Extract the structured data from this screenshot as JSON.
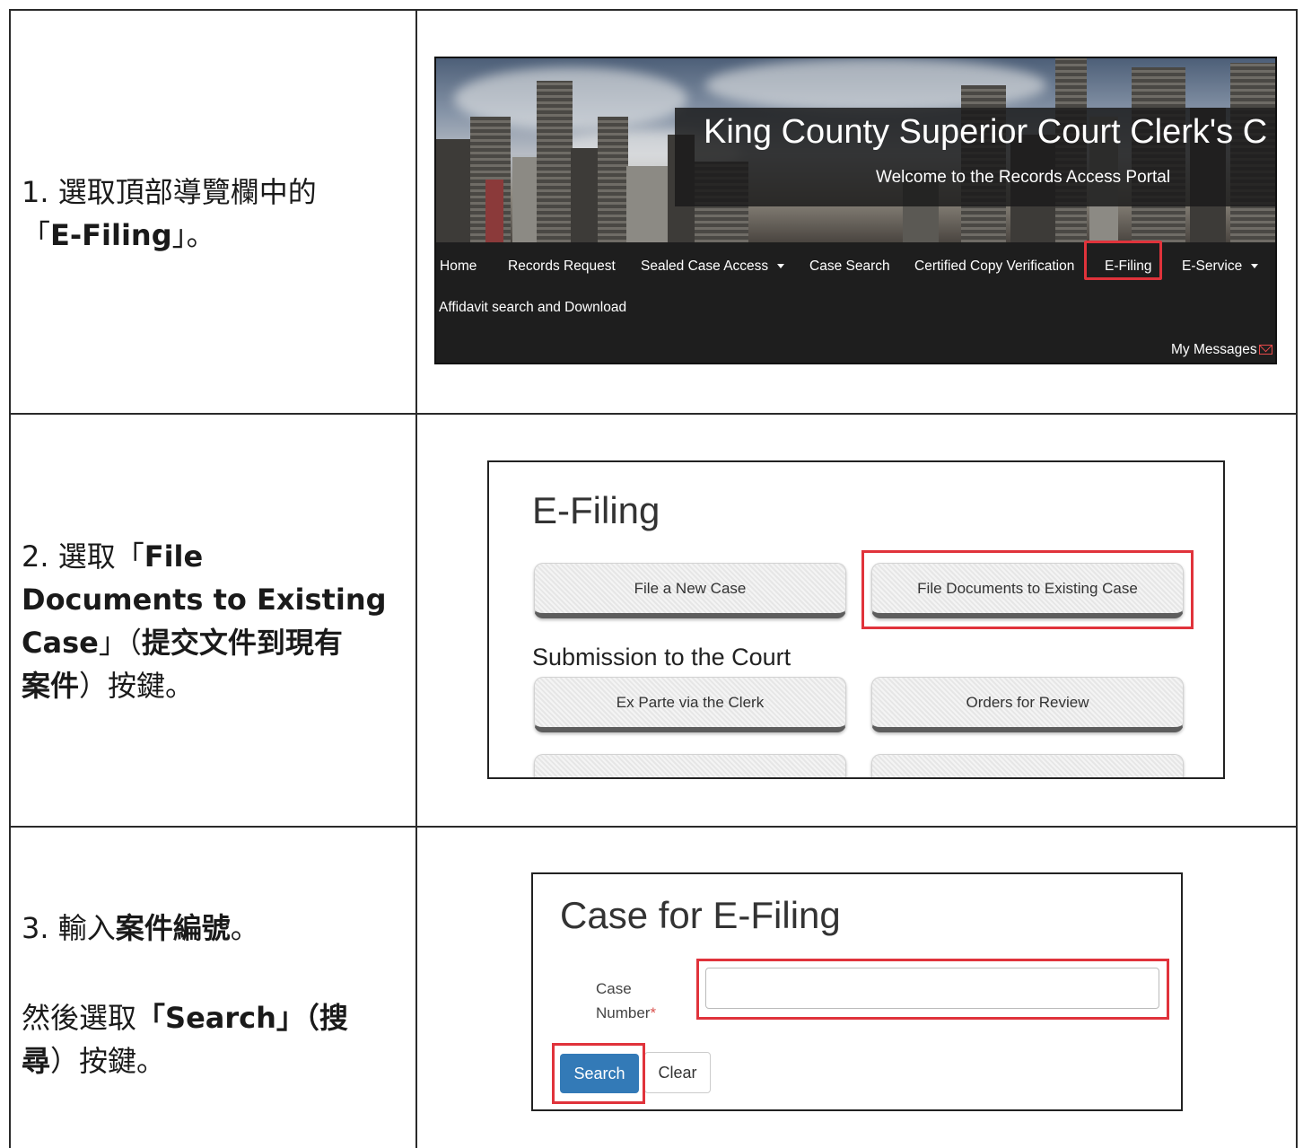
{
  "steps": [
    {
      "line1": "1.  選取頂部導覽欄中的",
      "line2_pre": "「",
      "line2_bold": "E-Filing",
      "line2_post": "」。"
    },
    {
      "line1_pre": "2.  選取「",
      "line1_bold": "File",
      "line2_bold": "Documents to Existing",
      "line3_bold": "Case",
      "line3_post": "」（",
      "line3_bold2": "提交文件到現有",
      "line4_bold": "案件",
      "line4_post": "）按鍵。"
    },
    {
      "line1_pre": "3.  輸入",
      "line1_bold": "案件編號",
      "line1_post": "。",
      "line2_pre": "然後選取",
      "line2_bold": "「Search」（搜",
      "line3_bold": "尋",
      "line3_post": "）按鍵。"
    }
  ],
  "portal": {
    "title": "King County Superior Court Clerk's C",
    "subtitle": "Welcome to the Records Access Portal",
    "nav": [
      "Home",
      "Records Request",
      "Sealed Case Access",
      "Case Search",
      "Certified Copy Verification",
      "E-Filing",
      "E-Service",
      "Affidavit search and Download"
    ],
    "messages": "My Messages"
  },
  "efiling": {
    "heading": "E-Filing",
    "btn_new_case": "File a New Case",
    "btn_existing_case": "File Documents to Existing Case",
    "submission_heading": "Submission to the Court",
    "btn_ex_parte": "Ex Parte via the Clerk",
    "btn_orders": "Orders for Review"
  },
  "case_form": {
    "heading": "Case for E-Filing",
    "label_line1": "Case",
    "label_line2": "Number",
    "required_mark": "*",
    "input_value": "",
    "search_label": "Search",
    "clear_label": "Clear"
  },
  "colors": {
    "highlight": "#e0333b",
    "primary_button": "#337ab7",
    "navbar": "#1e1e1e"
  }
}
